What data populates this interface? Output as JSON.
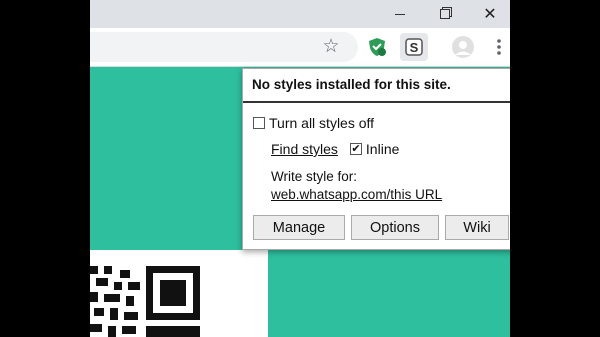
{
  "window": {
    "close_glyph": "✕"
  },
  "toolbar": {
    "star_icon": "star-icon",
    "star_glyph": "☆",
    "extension_stylus_letter": "S",
    "colors": {
      "ext_green": "#2e9b57",
      "ext_highlight": "#e6e7ea"
    }
  },
  "popup": {
    "title": "No styles installed for this site.",
    "turn_off_label": "Turn all styles off",
    "turn_off_checked": false,
    "find_styles_label": "Find styles",
    "inline_label": "Inline",
    "inline_checked": true,
    "check_glyph": "✔",
    "write_style_label": "Write style for:",
    "write_style_url": "web.whatsapp.com/this URL",
    "buttons": {
      "manage": "Manage",
      "options": "Options",
      "wiki": "Wiki"
    }
  },
  "page": {
    "accent_color": "#2ebf9f"
  }
}
